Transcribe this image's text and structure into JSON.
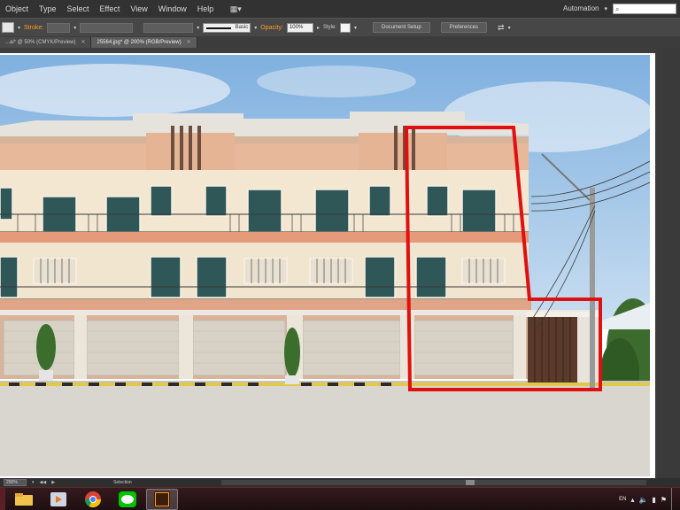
{
  "menu": {
    "items": [
      "Object",
      "Type",
      "Select",
      "Effect",
      "View",
      "Window",
      "Help"
    ],
    "workspace_label": "Automation",
    "search_placeholder": ""
  },
  "control": {
    "stroke_label": "Stroke:",
    "stroke_profile_label": "Basic",
    "opacity_label": "Opacity:",
    "opacity_value": "100%",
    "style_label": "Style:",
    "document_setup_label": "Document Setup",
    "preferences_label": "Preferences"
  },
  "tabs": [
    {
      "label": "...ai* @ 50% (CMYK/Preview)",
      "active": false
    },
    {
      "label": "25564.jpg* @ 200% (RGB/Preview)",
      "active": true
    }
  ],
  "status": {
    "zoom_value": "200%",
    "tool_label": "Selection"
  },
  "taskbar": {
    "apps": [
      "file-explorer-icon",
      "media-player-icon",
      "chrome-icon",
      "line-app-icon",
      "illustrator-icon"
    ],
    "language": "EN"
  },
  "colors": {
    "highlight_box": "#e01010",
    "sky": "#9cc3e6",
    "building_cream": "#f2e6d3",
    "building_pink": "#e9b39a",
    "window_teal": "#2f5757",
    "illustrator_orange": "#ff9d2e"
  }
}
